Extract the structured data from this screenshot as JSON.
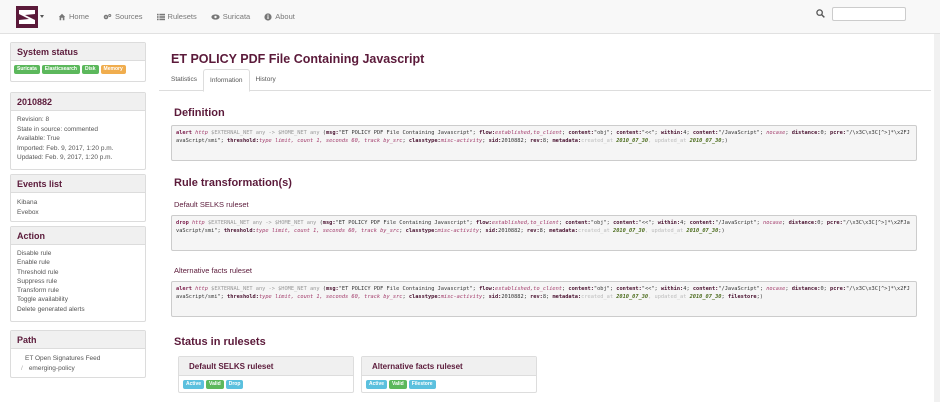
{
  "navbar": {
    "items": [
      {
        "label": "Home",
        "icon": "home-icon"
      },
      {
        "label": "Sources",
        "icon": "cogs-icon"
      },
      {
        "label": "Rulesets",
        "icon": "list-icon"
      },
      {
        "label": "Suricata",
        "icon": "eye-icon"
      },
      {
        "label": "About",
        "icon": "info-icon"
      }
    ],
    "search_value": ""
  },
  "sidebar": {
    "system_status": {
      "title": "System status",
      "badges": [
        {
          "label": "Suricata",
          "color": "#5cb85c"
        },
        {
          "label": "Elasticsearch",
          "color": "#5cb85c"
        },
        {
          "label": "Disk",
          "color": "#5cb85c"
        },
        {
          "label": "Memory",
          "color": "#f0ad4e"
        }
      ]
    },
    "rule_info": {
      "title": "2010882",
      "revision": "Revision: 8",
      "state": "State in source: commented",
      "available": "Available: True",
      "imported": "Imported: Feb. 9, 2017, 1:20 p.m.",
      "updated": "Updated: Feb. 9, 2017, 1:20 p.m."
    },
    "events": {
      "title": "Events list",
      "items": [
        "Kibana",
        "Evebox"
      ]
    },
    "action": {
      "title": "Action",
      "items": [
        "Disable rule",
        "Enable rule",
        "Threshold rule",
        "Suppress rule",
        "Transform rule",
        "Toggle availability",
        "Delete generated alerts"
      ]
    },
    "path": {
      "title": "Path",
      "feed": "ET Open Signatures Feed",
      "separator": "/",
      "sub": "emerging-policy"
    }
  },
  "main": {
    "title": "ET POLICY PDF File Containing Javascript",
    "tabs": [
      "Statistics",
      "Information",
      "History"
    ],
    "active_tab": "Information",
    "definition_heading": "Definition",
    "transformation_heading": "Rule transformation(s)",
    "transform_default_heading": "Default SELKS ruleset",
    "transform_alt_heading": "Alternative facts ruleset",
    "status_heading": "Status in rulesets",
    "rule": {
      "alert_action": "alert",
      "drop_action": "drop",
      "proto": "http",
      "src": "$EXTERNAL_NET any -> $HOME_NET any",
      "msg": "\"ET POLICY PDF File Containing Javascript\"",
      "flow": "established,to_client",
      "content1": "\"obj\"",
      "content2": "\"<<\"",
      "within": "4",
      "content3": "\"/JavaScript\"",
      "distance": "0",
      "pcre": "\"/\\x3C\\x3C[^>]*\\x2FJavaScript/smi\"",
      "threshold": "type limit, count 1, seconds 60, track by_src",
      "classtype": "misc-activity",
      "sid": "2010882",
      "rev": "8",
      "created_at": "2010_07_30",
      "updated_at": "2010_07_30",
      "filestore": "filestore"
    },
    "status_cards": [
      {
        "title": "Default SELKS ruleset",
        "badges": [
          {
            "label": "Active",
            "color": "#5bc0de"
          },
          {
            "label": "Valid",
            "color": "#5cb85c"
          },
          {
            "label": "Drop",
            "color": "#5bc0de"
          }
        ]
      },
      {
        "title": "Alternative facts ruleset",
        "badges": [
          {
            "label": "Active",
            "color": "#5bc0de"
          },
          {
            "label": "Valid",
            "color": "#5cb85c"
          },
          {
            "label": "Filestore",
            "color": "#5bc0de"
          }
        ]
      }
    ]
  }
}
